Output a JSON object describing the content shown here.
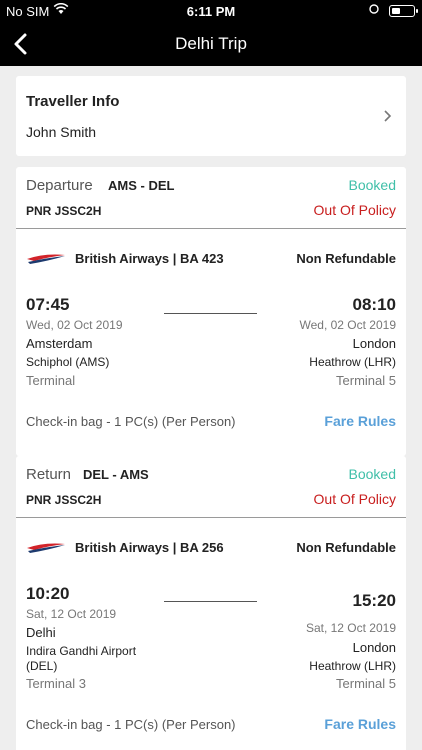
{
  "status_bar": {
    "carrier": "No SIM",
    "time": "6:11 PM"
  },
  "nav": {
    "title": "Delhi Trip"
  },
  "traveller": {
    "heading": "Traveller Info",
    "name": "John Smith"
  },
  "departure": {
    "type": "Departure",
    "route": "AMS - DEL",
    "status": "Booked",
    "pnr": "PNR JSSC2H",
    "policy": "Out Of Policy",
    "airline": "British Airways | BA 423",
    "refund": "Non Refundable",
    "dep_time": "07:45",
    "dep_date": "Wed, 02 Oct 2019",
    "dep_city": "Amsterdam",
    "dep_airport": "Schiphol (AMS)",
    "dep_terminal": "Terminal",
    "arr_time": "08:10",
    "arr_date": "Wed, 02 Oct 2019",
    "arr_city": "London",
    "arr_airport": "Heathrow (LHR)",
    "arr_terminal": "Terminal 5",
    "bag": "Check-in bag - 1 PC(s) (Per Person)",
    "fare_rules": "Fare Rules"
  },
  "return": {
    "type": "Return",
    "route": "DEL - AMS",
    "status": "Booked",
    "pnr": "PNR JSSC2H",
    "policy": "Out Of Policy",
    "airline": "British Airways | BA 256",
    "refund": "Non Refundable",
    "dep_time": "10:20",
    "dep_date": "Sat, 12 Oct 2019",
    "dep_city": "Delhi",
    "dep_airport_1": "Indira Gandhi Airport",
    "dep_airport_2": "(DEL)",
    "dep_terminal": "Terminal 3",
    "arr_time": "15:20",
    "arr_date": "Sat, 12 Oct 2019",
    "arr_city": "London",
    "arr_airport": "Heathrow (LHR)",
    "arr_terminal": "Terminal 5",
    "bag": "Check-in bag - 1 PC(s) (Per Person)",
    "fare_rules": "Fare Rules"
  },
  "colors": {
    "booked": "#3fbfa8",
    "policy": "#c81e1e",
    "link": "#5aa0d8",
    "ba_red": "#d2232a",
    "ba_blue": "#1d3a6e"
  }
}
